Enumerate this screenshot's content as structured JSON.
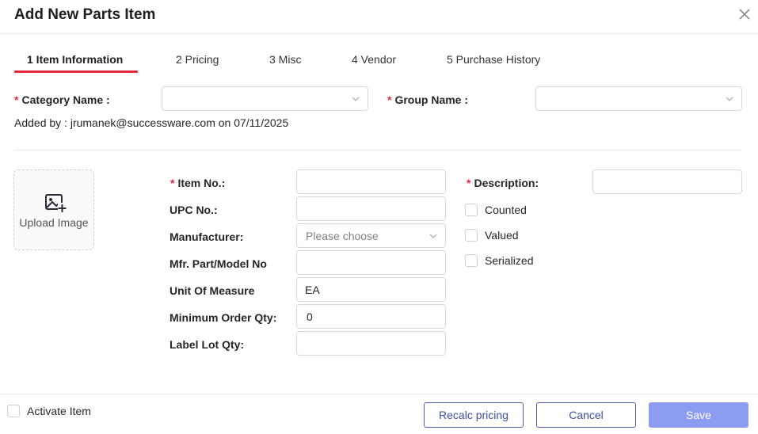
{
  "dialog": {
    "title": "Add New Parts Item"
  },
  "tabs": [
    {
      "label": "1 Item Information"
    },
    {
      "label": "2 Pricing"
    },
    {
      "label": "3 Misc"
    },
    {
      "label": "4 Vendor"
    },
    {
      "label": "5 Purchase History"
    }
  ],
  "header_fields": {
    "category_label": "Category Name",
    "category_value": "",
    "group_label": "Group Name",
    "group_value": "",
    "added_by": "Added by : jrumanek@successware.com on 07/11/2025"
  },
  "upload": {
    "label": "Upload Image"
  },
  "form": {
    "item_no_label": "Item No.",
    "item_no_value": "",
    "upc_label": "UPC No.",
    "upc_value": "",
    "manufacturer_label": "Manufacturer",
    "manufacturer_placeholder": "Please choose",
    "mfr_part_label": "Mfr. Part/Model No",
    "mfr_part_value": "",
    "uom_label": "Unit Of Measure",
    "uom_value": "EA",
    "min_order_label": "Minimum Order Qty",
    "min_order_value": "0",
    "label_lot_label": "Label Lot Qty",
    "label_lot_value": "",
    "description_label": "Description",
    "description_value": "",
    "colon": ":"
  },
  "checkboxes": [
    {
      "label": "Counted",
      "checked": false
    },
    {
      "label": "Valued",
      "checked": false
    },
    {
      "label": "Serialized",
      "checked": false
    }
  ],
  "footer": {
    "activate_label": "Activate Item",
    "activate_checked": false,
    "recalc_label": "Recalc pricing",
    "cancel_label": "Cancel",
    "save_label": "Save"
  },
  "colors": {
    "accent_red": "#e0283f",
    "primary_disabled": "#8c9cf0",
    "outline_blue": "#3b4fa3"
  }
}
